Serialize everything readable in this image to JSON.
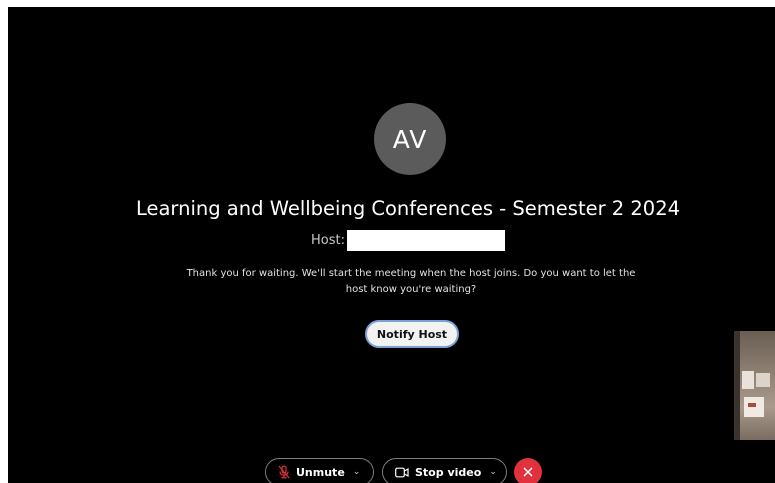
{
  "meeting": {
    "avatar_initials": "AV",
    "title": "Learning and Wellbeing Conferences - Semester 2 2024",
    "host_label": "Host:",
    "waiting_message": "Thank you for waiting. We'll start the meeting when the host joins. Do you want to let the host know you're waiting?",
    "notify_host_label": "Notify Host"
  },
  "controls": {
    "unmute_label": "Unmute",
    "stop_video_label": "Stop video",
    "unmute_icon": "microphone-muted-icon",
    "video_icon": "video-camera-icon",
    "leave_icon": "close-icon"
  },
  "colors": {
    "background": "#000000",
    "avatar": "#5b5b5b",
    "leave_button": "#e0323d",
    "notify_border": "#7aa2d6",
    "muted_icon": "#e0323d"
  }
}
